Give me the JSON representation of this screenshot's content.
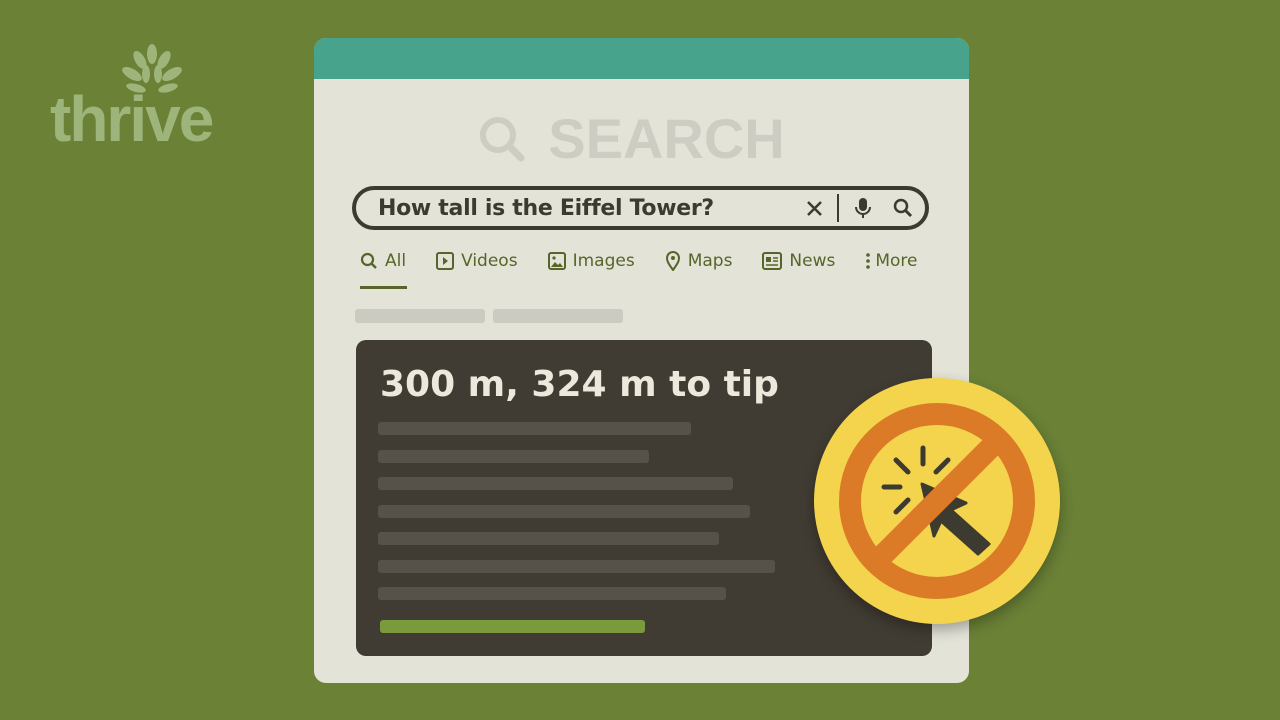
{
  "logo": {
    "text": "thrive"
  },
  "window": {
    "title": "SEARCH"
  },
  "search": {
    "query": "How tall is the Eiffel Tower?"
  },
  "tabs": [
    {
      "label": "All",
      "icon": "search-icon",
      "active": true
    },
    {
      "label": "Videos",
      "icon": "play-icon"
    },
    {
      "label": "Images",
      "icon": "image-icon"
    },
    {
      "label": "Maps",
      "icon": "map-pin-icon"
    },
    {
      "label": "News",
      "icon": "news-icon"
    },
    {
      "label": "More",
      "icon": "more-vertical-icon"
    }
  ],
  "result": {
    "answer": "300 m, 324 m to tip"
  },
  "badge": {
    "icon": "no-click-icon"
  },
  "colors": {
    "background": "#6a8136",
    "header": "#47a38b",
    "card": "#413c33",
    "badge": "#f4d44d",
    "prohibit": "#db7a27"
  }
}
